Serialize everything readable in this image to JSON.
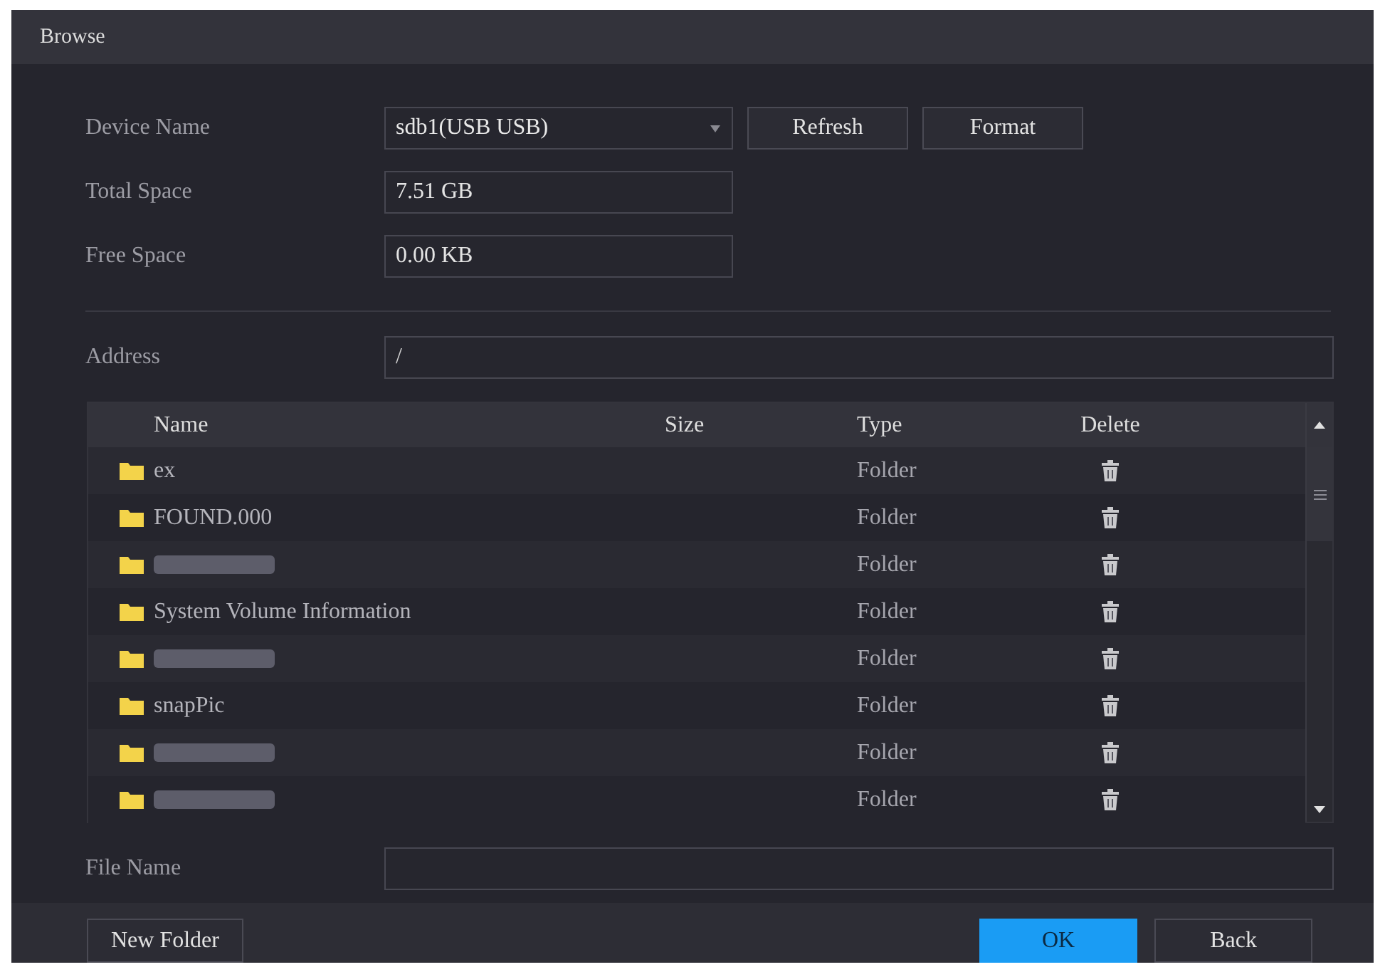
{
  "window": {
    "title": "Browse"
  },
  "device": {
    "label": "Device Name",
    "value": "sdb1(USB USB)",
    "buttons": [
      "Refresh",
      "Format"
    ]
  },
  "total_space": {
    "label": "Total Space",
    "value": "7.51 GB"
  },
  "free_space": {
    "label": "Free Space",
    "value": "0.00 KB"
  },
  "address": {
    "label": "Address",
    "value": "/"
  },
  "table": {
    "columns": [
      "Name",
      "Size",
      "Type",
      "Delete"
    ],
    "rows": [
      {
        "name": "ex",
        "blurred": false,
        "type": "Folder"
      },
      {
        "name": "FOUND.000",
        "blurred": false,
        "type": "Folder"
      },
      {
        "blurred": true,
        "type": "Folder"
      },
      {
        "name": "System Volume Information",
        "blurred": false,
        "type": "Folder"
      },
      {
        "blurred": true,
        "type": "Folder"
      },
      {
        "name": "snapPic",
        "blurred": false,
        "type": "Folder"
      },
      {
        "blurred": true,
        "type": "Folder"
      },
      {
        "blurred": true,
        "type": "Folder"
      }
    ]
  },
  "file_name": {
    "label": "File Name"
  },
  "footer": {
    "left": [
      {
        "label": "New Folder",
        "kind": "normal"
      }
    ],
    "right": [
      {
        "label": "OK",
        "kind": "primary"
      },
      {
        "label": "Back",
        "kind": "normal"
      }
    ]
  }
}
